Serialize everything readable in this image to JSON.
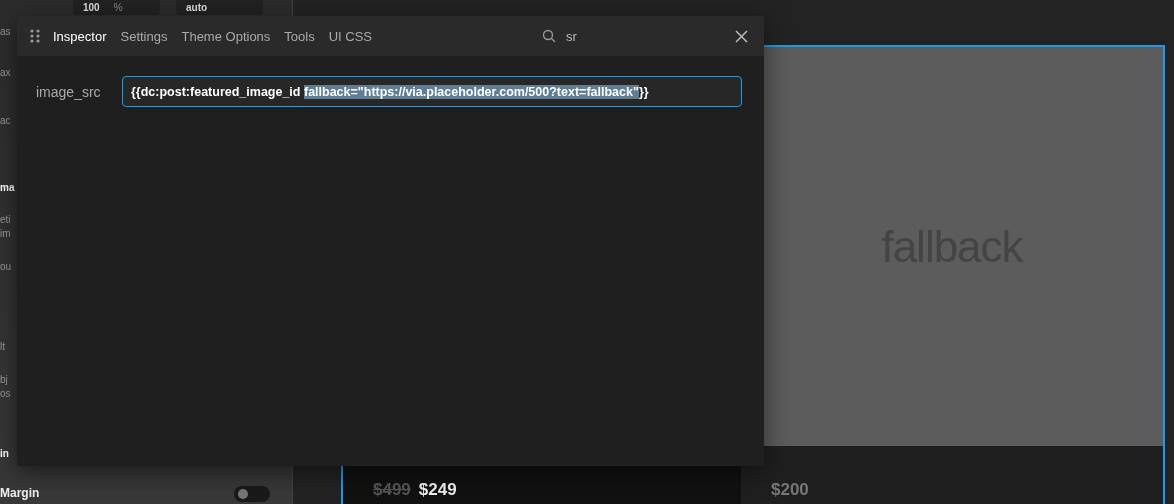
{
  "sidebar": {
    "fields": [
      {
        "value": "100",
        "unit": "%"
      },
      {
        "value": "auto"
      }
    ],
    "labels": [
      {
        "text": "as",
        "kind": "plain"
      },
      {
        "text": "ax",
        "kind": "plain"
      },
      {
        "text": "ac",
        "kind": "plain"
      },
      {
        "text": "ma",
        "kind": "heading"
      },
      {
        "text": "eti",
        "kind": "plain"
      },
      {
        "text": "im",
        "kind": "plain"
      },
      {
        "text": "ou",
        "kind": "plain"
      },
      {
        "text": "lt",
        "kind": "plain"
      },
      {
        "text": "bj",
        "kind": "plain"
      },
      {
        "text": "os",
        "kind": "plain"
      },
      {
        "text": "in",
        "kind": "heading"
      }
    ],
    "bottom_label": "Margin",
    "toggle": {
      "on": false
    }
  },
  "canvas": {
    "cards": [
      {
        "old_price": "$499",
        "price": "$249"
      },
      {
        "image_text": "fallback",
        "price": "$200"
      }
    ]
  },
  "inspector": {
    "tabs": [
      {
        "label": "Inspector",
        "selected": true
      },
      {
        "label": "Settings",
        "selected": false
      },
      {
        "label": "Theme Options",
        "selected": false
      },
      {
        "label": "Tools",
        "selected": false
      },
      {
        "label": "UI CSS",
        "selected": false
      }
    ],
    "search": {
      "value": "sr"
    },
    "fields": [
      {
        "label": "image_src",
        "value_parts": [
          {
            "text": "{{dc:post:featured_image_id ",
            "selected": false
          },
          {
            "text": "fallback=\"https://via.placeholder.com/500?text=fallback\"",
            "selected": true
          },
          {
            "text": "}}",
            "selected": false
          }
        ]
      }
    ]
  }
}
